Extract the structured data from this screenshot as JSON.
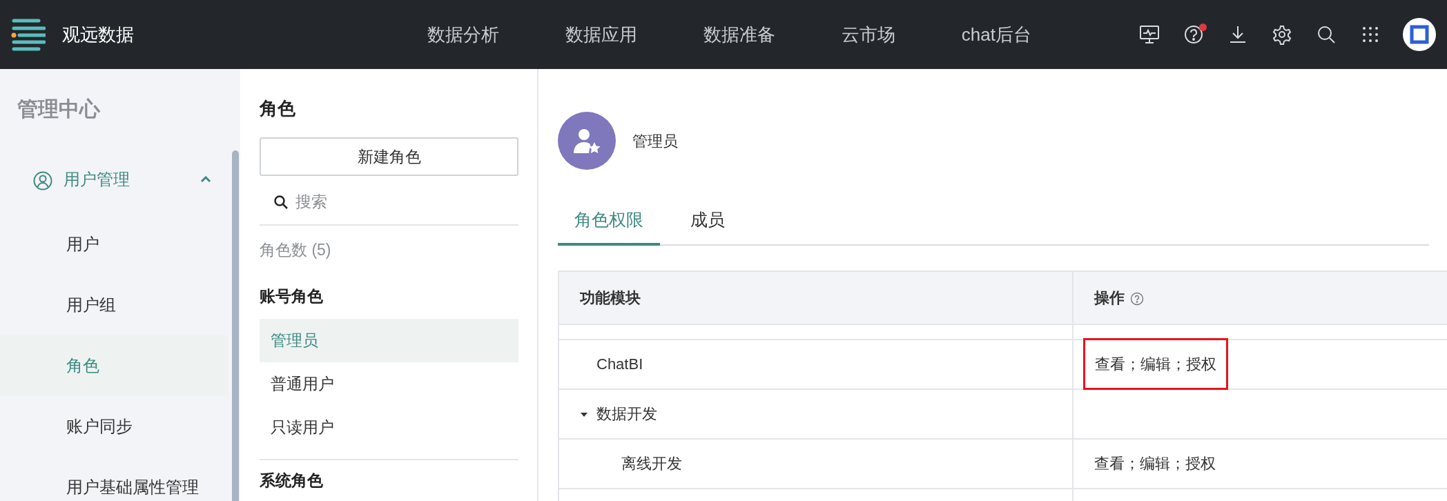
{
  "app": {
    "name": "观远数据"
  },
  "nav": [
    {
      "label": "数据分析"
    },
    {
      "label": "数据应用"
    },
    {
      "label": "数据准备"
    },
    {
      "label": "云市场"
    },
    {
      "label": "chat后台"
    }
  ],
  "header_icons": [
    {
      "kind": "monitor"
    },
    {
      "kind": "help",
      "badge": true
    },
    {
      "kind": "download"
    },
    {
      "kind": "settings"
    },
    {
      "kind": "search"
    },
    {
      "kind": "apps"
    },
    {
      "kind": "avatar"
    }
  ],
  "sidebar": {
    "title": "管理中心",
    "groups": [
      {
        "label": "用户管理",
        "expanded": true,
        "items": [
          {
            "label": "用户",
            "selected": false
          },
          {
            "label": "用户组",
            "selected": false
          },
          {
            "label": "角色",
            "selected": true
          },
          {
            "label": "账户同步",
            "selected": false
          },
          {
            "label": "用户基础属性管理",
            "selected": false
          }
        ]
      }
    ]
  },
  "roles_panel": {
    "title": "角色",
    "new_button": "新建角色",
    "search": {
      "placeholder": "搜索"
    },
    "count": "角色数 (5)",
    "sections": [
      {
        "title": "账号角色",
        "roles": [
          {
            "label": "管理员",
            "selected": true
          },
          {
            "label": "普通用户",
            "selected": false
          },
          {
            "label": "只读用户",
            "selected": false
          }
        ]
      },
      {
        "title": "系统角色"
      }
    ]
  },
  "detail": {
    "role_name": "管理员",
    "tabs": [
      {
        "label": "角色权限",
        "selected": true
      },
      {
        "label": "成员",
        "selected": false
      }
    ],
    "table": {
      "columns": [
        "功能模块",
        "操作"
      ],
      "rows": [
        {
          "module": "ChatBI",
          "actions": "查看；编辑；授权",
          "highlighted": true
        },
        {
          "module": "数据开发",
          "expanded": true,
          "children": [
            {
              "module": "离线开发",
              "actions": "查看；编辑；授权",
              "highlighted": false
            }
          ]
        }
      ]
    }
  }
}
